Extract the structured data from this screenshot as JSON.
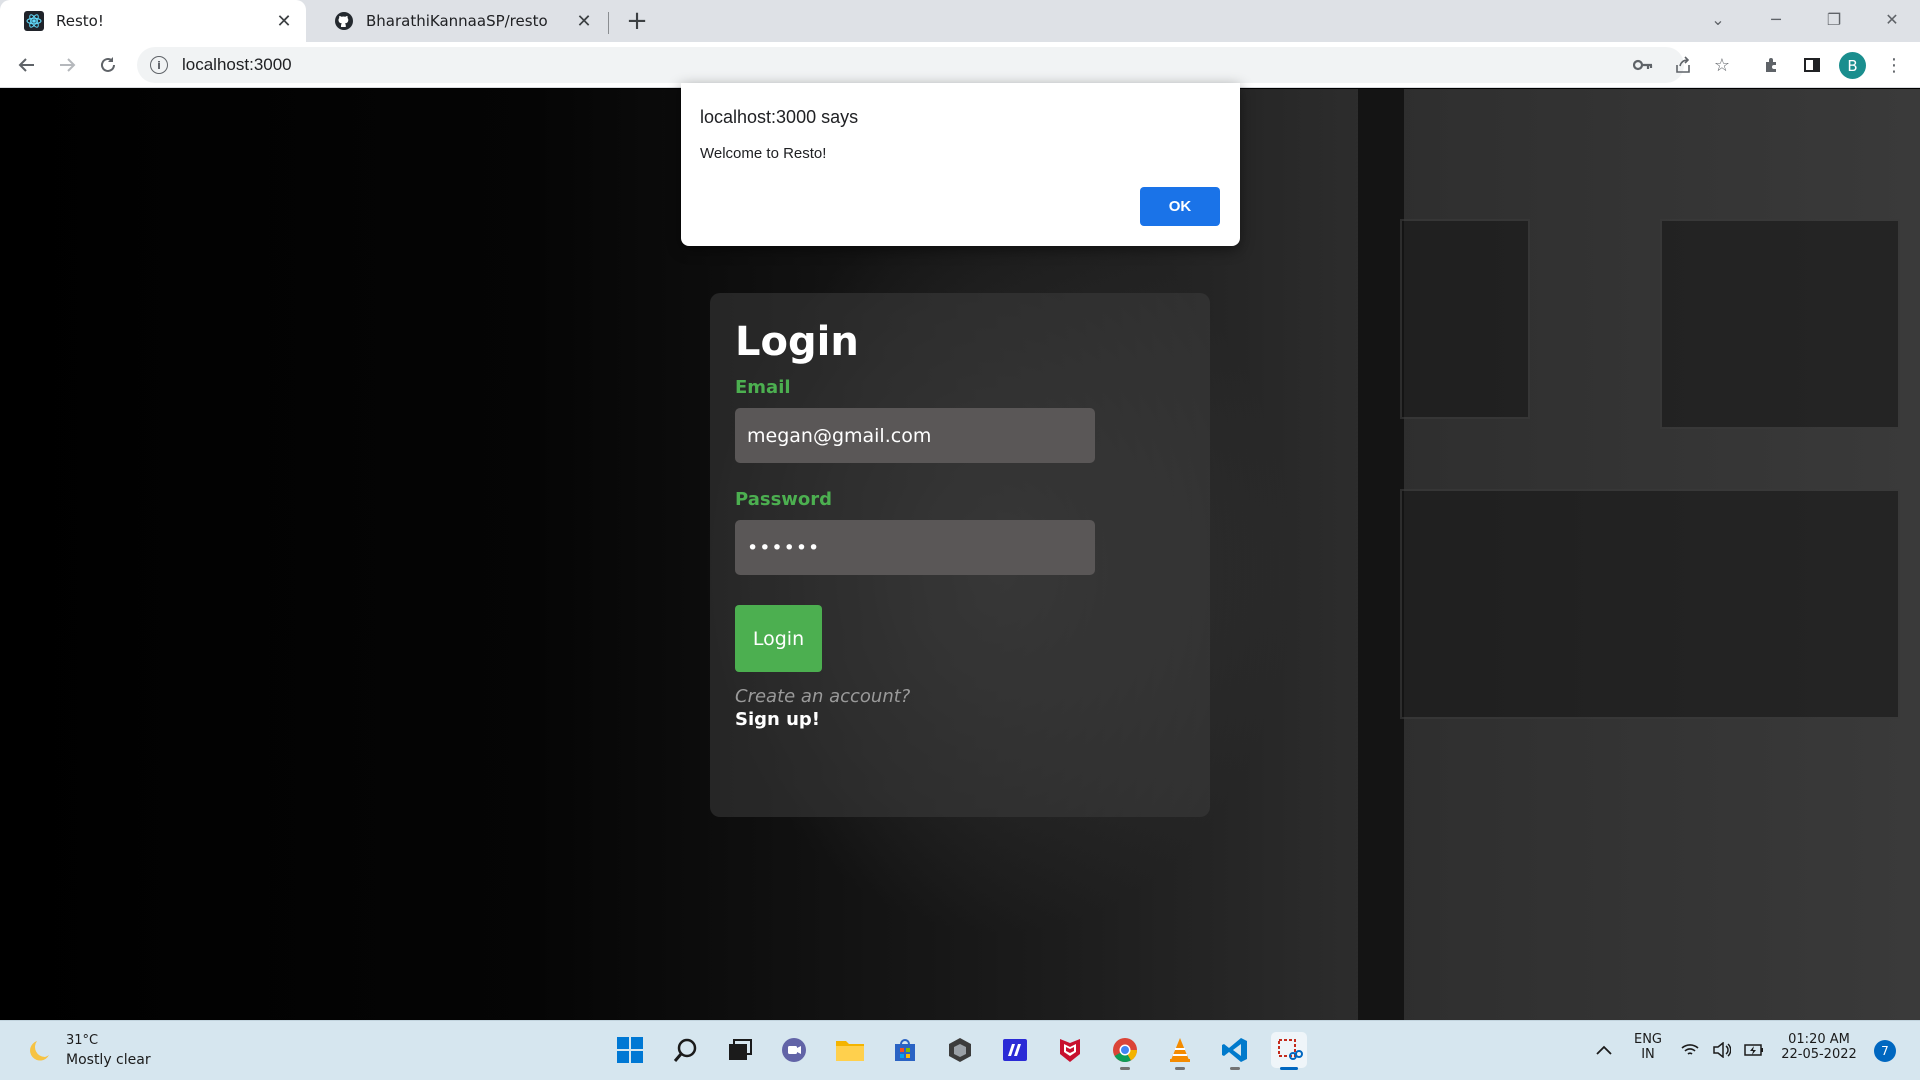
{
  "browser": {
    "tabs": [
      {
        "title": "Resto!",
        "favicon": "react-icon",
        "active": true
      },
      {
        "title": "BharathiKannaaSP/resto",
        "favicon": "github-icon",
        "active": false
      }
    ],
    "address": "localhost:3000"
  },
  "dialog": {
    "title": "localhost:3000 says",
    "message": "Welcome to Resto!",
    "ok_label": "OK"
  },
  "login": {
    "heading": "Login",
    "email_label": "Email",
    "email_value": "megan@gmail.com",
    "password_label": "Password",
    "password_value": "••••••",
    "button_label": "Login",
    "create_text": "Create an account?",
    "signup_label": "Sign up!",
    "accent_color": "#4caf50"
  },
  "taskbar": {
    "weather_temp": "31°C",
    "weather_desc": "Mostly clear",
    "lang_line1": "ENG",
    "lang_line2": "IN",
    "time": "01:20 AM",
    "date": "22-05-2022",
    "notification_count": "7"
  },
  "profile": {
    "initial": "B"
  }
}
